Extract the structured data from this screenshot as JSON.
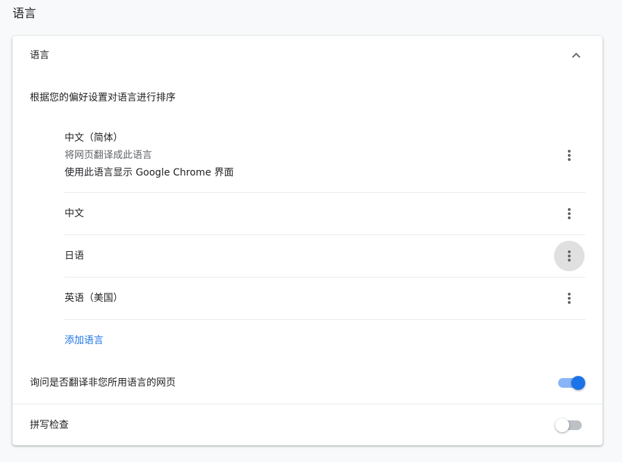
{
  "page": {
    "title": "语言"
  },
  "section": {
    "title": "语言",
    "order_description": "根据您的偏好设置对语言进行排序",
    "languages": [
      {
        "name": "中文（简体）",
        "subtitle": "将网页翻译成此语言",
        "ui_note": "使用此语言显示 Google Chrome 界面"
      },
      {
        "name": "中文"
      },
      {
        "name": "日语"
      },
      {
        "name": "英语（美国）"
      }
    ],
    "add_language_label": "添加语言"
  },
  "settings": {
    "translate_prompt": {
      "label": "询问是否翻译非您所用语言的网页",
      "enabled": true
    },
    "spell_check": {
      "label": "拼写检查",
      "enabled": false
    }
  },
  "colors": {
    "accent": "#1a73e8",
    "toggle_track_on": "#8ab4f8",
    "toggle_track_off": "#bdc1c6",
    "divider": "#e8eaed",
    "hover_circle": "#e0e0e0",
    "icon": "#5f6368"
  },
  "icons": {
    "collapse": "chevron-up-icon",
    "more": "more-vert-icon"
  }
}
